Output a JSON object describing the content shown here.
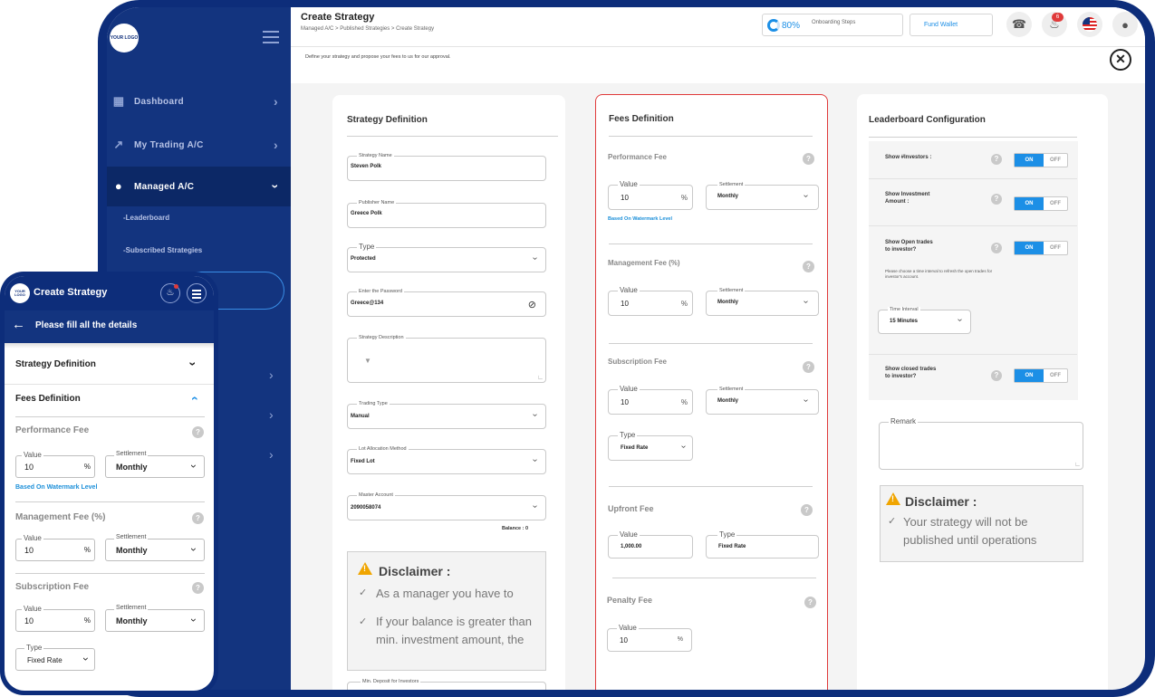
{
  "header": {
    "title": "Create Strategy",
    "breadcrumb": "Managed A/C > Published Strategies > Create Strategy",
    "progress_value": "80%",
    "progress_label": "Onboarding Steps",
    "fund_wallet": "Fund Wallet",
    "notification_count": "6"
  },
  "subheader": {
    "intro": "Define your strategy and propose your fees to us for our approval."
  },
  "logo_text": "YOUR LOGO",
  "sidebar": {
    "items": [
      {
        "label": "Dashboard",
        "icon": "dashboard-icon"
      },
      {
        "label": "My Trading A/C",
        "icon": "chart-icon"
      },
      {
        "label": "Managed A/C",
        "icon": "users-icon"
      }
    ],
    "sub_items": [
      "-Leaderboard",
      "-Subscribed Strategies"
    ]
  },
  "strategy": {
    "title": "Strategy Definition",
    "name_label": "Strategy Name",
    "name_value": "Steven Polk",
    "publisher_label": "Publisher Name",
    "publisher_value": "Greece Polk",
    "type_label": "Type",
    "type_value": "Protected",
    "password_label": "Enter the Password",
    "password_value": "Greece@134",
    "description_label": "Strategy Description",
    "trading_type_label": "Trading Type",
    "trading_type_value": "Manual",
    "lot_label": "Lot Allocation Method",
    "lot_value": "Fixed Lot",
    "master_label": "Master Account",
    "master_value": "2090058074",
    "balance": "Balance : 0",
    "disclaimer_title": "Disclaimer :",
    "disclaimer_1": "As a manager you have to",
    "disclaimer_2a": "If your balance is greater than",
    "disclaimer_2b": "min. investment amount, the",
    "min_deposit_label": "Min. Deposit for Investors"
  },
  "fees": {
    "title": "Fees Definition",
    "performance": "Performance Fee",
    "management": "Management Fee (%)",
    "subscription": "Subscription Fee",
    "upfront": "Upfront Fee",
    "penalty": "Penalty Fee",
    "value_label": "Value",
    "settlement_label": "Settlement",
    "type_label": "Type",
    "value": "10",
    "percent": "%",
    "monthly": "Monthly",
    "watermark": "Based On Watermark Level",
    "fixed_rate": "Fixed Rate",
    "upfront_value": "1,000.00"
  },
  "leaderboard": {
    "title": "Leaderboard Configuration",
    "show_investors": "Show #Investors :",
    "show_investment_1": "Show Investment",
    "show_investment_2": "Amount :",
    "show_open_1": "Show Open trades",
    "show_open_2": "to investor?",
    "interval_note_1": "Please choose a time interval to refresh the open trades for",
    "interval_note_2": "investor's account.",
    "interval_label": "Time Interval",
    "interval_value": "15 Minutes",
    "show_closed_1": "Show closed trades",
    "show_closed_2": "to investor?",
    "on": "ON",
    "off": "OFF",
    "remark_label": "Remark",
    "disclaimer_title": "Disclaimer :",
    "disclaimer_1": "Your strategy will not be",
    "disclaimer_2": "published until operations"
  },
  "mobile": {
    "title": "Create Strategy",
    "subtitle": "Please fill all the details",
    "strategy_def": "Strategy Definition",
    "fees_def": "Fees Definition",
    "performance": "Performance Fee",
    "management": "Management Fee  (%)",
    "subscription": "Subscription Fee",
    "value_label": "Value",
    "settlement_label": "Settlement",
    "type_label": "Type",
    "value": "10",
    "percent": "%",
    "monthly": "Monthly",
    "watermark": "Based On Watermark Level",
    "fixed_rate": "Fixed Rate"
  },
  "colors": {
    "navy": "#0d2d7a",
    "accent": "#1c8fe6",
    "warning": "#f0a500",
    "fees_border": "#e03a3a"
  }
}
